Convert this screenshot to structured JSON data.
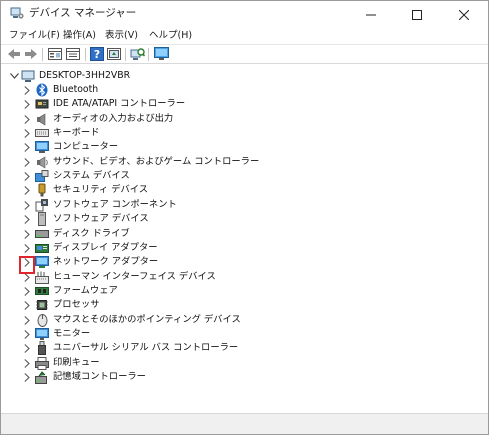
{
  "window": {
    "title": "デバイス マネージャー"
  },
  "menu": {
    "items": [
      "ファイル(F)",
      "操作(A)",
      "表示(V)",
      "ヘルプ(H)"
    ]
  },
  "toolbar": {
    "buttons": [
      "back-icon",
      "forward-icon",
      "device-view-icon",
      "properties-icon",
      "help-icon",
      "update-driver-icon",
      "scan-hardware-icon",
      "monitor-icon"
    ]
  },
  "tree": {
    "root": "DESKTOP-3HH2VBR",
    "items": [
      {
        "label": "Bluetooth",
        "icon": "bluetooth-icon"
      },
      {
        "label": "IDE ATA/ATAPI コントローラー",
        "icon": "ide-controller-icon"
      },
      {
        "label": "オーディオの入力および出力",
        "icon": "speaker-icon"
      },
      {
        "label": "キーボード",
        "icon": "keyboard-icon"
      },
      {
        "label": "コンピューター",
        "icon": "computer-icon"
      },
      {
        "label": "サウンド、ビデオ、およびゲーム コントローラー",
        "icon": "sound-icon"
      },
      {
        "label": "システム デバイス",
        "icon": "system-device-icon"
      },
      {
        "label": "セキュリティ デバイス",
        "icon": "security-key-icon"
      },
      {
        "label": "ソフトウェア コンポーネント",
        "icon": "software-component-icon"
      },
      {
        "label": "ソフトウェア デバイス",
        "icon": "software-device-icon"
      },
      {
        "label": "ディスク ドライブ",
        "icon": "disk-drive-icon"
      },
      {
        "label": "ディスプレイ アダプター",
        "icon": "display-adapter-icon"
      },
      {
        "label": "ネットワーク アダプター",
        "icon": "network-adapter-icon"
      },
      {
        "label": "ヒューマン インターフェイス デバイス",
        "icon": "hid-icon"
      },
      {
        "label": "ファームウェア",
        "icon": "firmware-icon"
      },
      {
        "label": "プロセッサ",
        "icon": "processor-icon"
      },
      {
        "label": "マウスとそのほかのポインティング デバイス",
        "icon": "mouse-icon"
      },
      {
        "label": "モニター",
        "icon": "monitor-icon"
      },
      {
        "label": "ユニバーサル シリアル バス コントローラー",
        "icon": "usb-icon"
      },
      {
        "label": "印刷キュー",
        "icon": "printer-icon"
      },
      {
        "label": "記憶域コントローラー",
        "icon": "storage-controller-icon"
      }
    ]
  },
  "highlight": {
    "target": "ネットワーク アダプター",
    "color": "#e0262b"
  },
  "status": {
    "text": ""
  }
}
